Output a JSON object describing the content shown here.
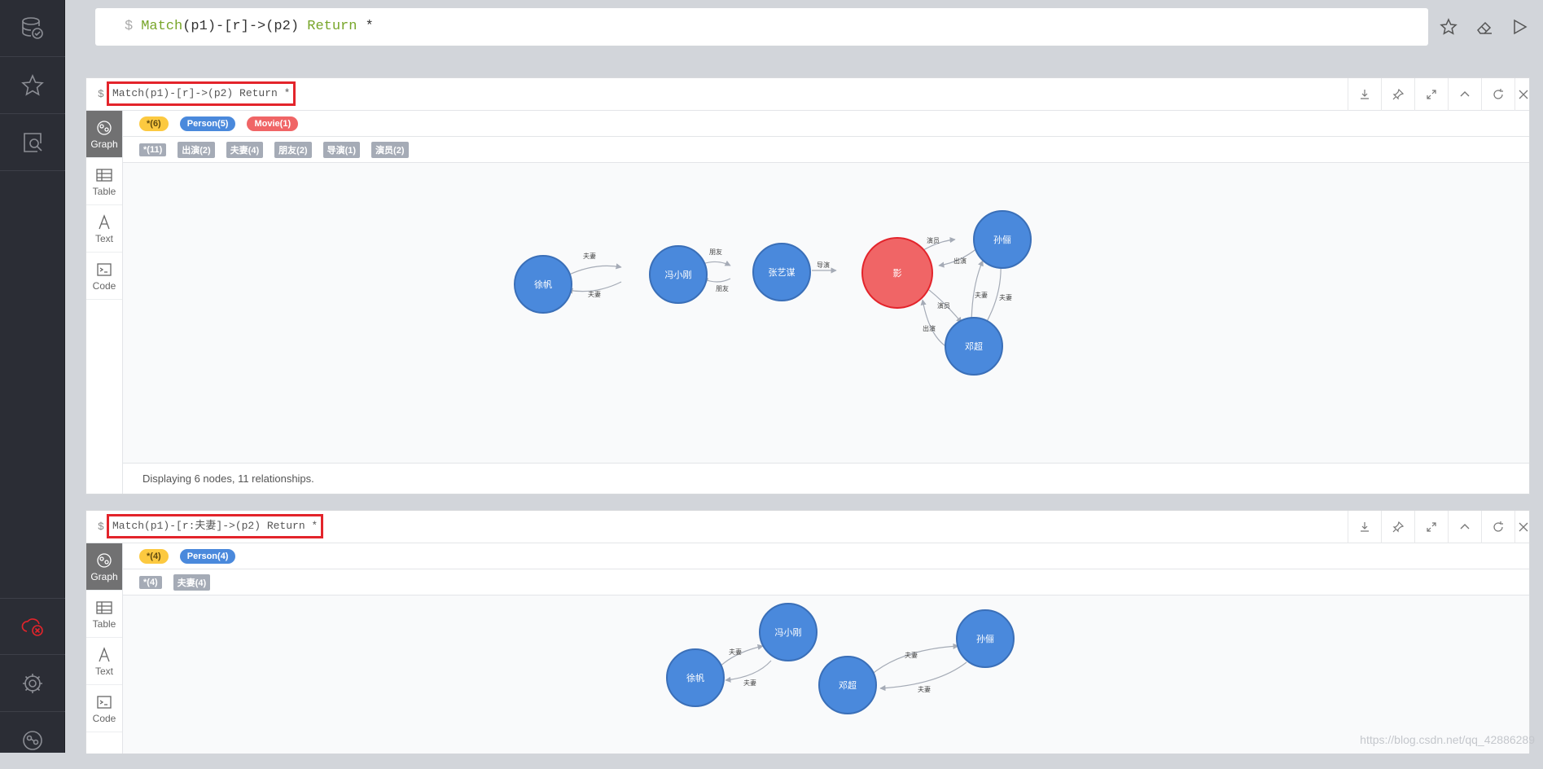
{
  "editor": {
    "prompt": "$",
    "keyword_match": "Match",
    "body": "(p1)-[r]->(p2)",
    "keyword_return": "Return",
    "tail": "*"
  },
  "icons": [
    "database-icon",
    "star-icon",
    "search-doc-icon",
    "cloud-error-icon",
    "gear-icon",
    "neo4j-logo-icon",
    "favorite-icon",
    "eraser-icon",
    "play-icon"
  ],
  "colors": {
    "accent_red": "#e3242b",
    "person": "#4a89dc",
    "movie": "#f06566",
    "all": "#fcc940",
    "rel_tag": "#a5abb6"
  },
  "sidetabs": [
    "Graph",
    "Table",
    "Text",
    "Code"
  ],
  "frame1": {
    "prompt": "$",
    "query": "Match(p1)-[r]->(p2) Return *",
    "labels": [
      {
        "text": "*(6)"
      },
      {
        "text": "Person(5)"
      },
      {
        "text": "Movie(1)"
      }
    ],
    "rels": [
      "*(11)",
      "出演(2)",
      "夫妻(4)",
      "朋友(2)",
      "导演(1)",
      "演员(2)"
    ],
    "status": "Displaying 6 nodes, 11 relationships.",
    "nodes": {
      "xufan": "徐帆",
      "feng": "冯小刚",
      "zhang": "张艺谋",
      "ying": "影",
      "sunli": "孙俪",
      "dengchao": "邓超"
    },
    "edges": {
      "fuqi": "夫妻",
      "pengyou": "朋友",
      "daoyan": "导演",
      "yanyuan": "演员",
      "chuyan": "出演"
    }
  },
  "frame2": {
    "prompt": "$",
    "query": "Match(p1)-[r:夫妻]->(p2) Return *",
    "labels": [
      {
        "text": "*(4)"
      },
      {
        "text": "Person(4)"
      }
    ],
    "rels": [
      "*(4)",
      "夫妻(4)"
    ],
    "nodes": {
      "feng": "冯小刚",
      "xufan": "徐帆",
      "sunli": "孙俪",
      "dengchao": "邓超"
    },
    "edges": {
      "fuqi": "夫妻"
    }
  },
  "watermark": "https://blog.csdn.net/qq_42886289"
}
